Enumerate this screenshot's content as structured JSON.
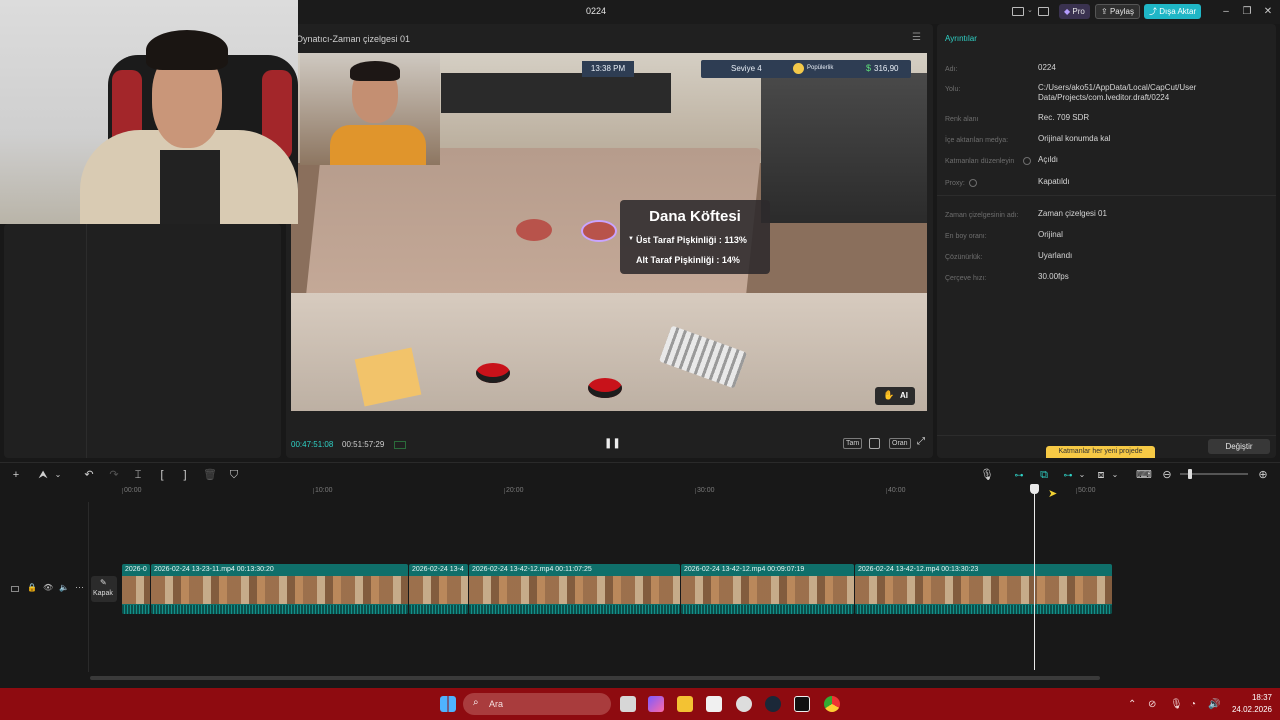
{
  "window": {
    "title": "0224",
    "pro": "Pro",
    "share": "Paylaş",
    "export": "Dışa Aktar"
  },
  "player": {
    "title": "Oynatıcı-Zaman çizelgesi 01",
    "current_time": "00:47:51:08",
    "total_time": "00:51:57:29",
    "btn_full": "Tam",
    "btn_ratio": "Oran",
    "ai": "AI"
  },
  "game": {
    "clock": "13:38 PM",
    "level": "Seviye 4",
    "popularity": "Popülerlik",
    "money": "316,90",
    "popup_title": "Dana Köftesi",
    "popup_line1": "Üst Taraf Pişkinliği : 113%",
    "popup_line2": "Alt Taraf Pişkinliği : 14%"
  },
  "details": {
    "heading": "Ayrıntılar",
    "rows": [
      {
        "label": "Adı:",
        "value": "0224"
      },
      {
        "label": "Yolu:",
        "value": "C:/Users/ako51/AppData/Local/CapCut/User Data/Projects/com.lveditor.draft/0224"
      },
      {
        "label": "Renk alanı",
        "value": "Rec. 709 SDR"
      },
      {
        "label": "İçe aktarılan medya:",
        "value": "Orijinal konumda kal"
      },
      {
        "label": "Katmanları düzenleyin",
        "value": "Açıldı"
      },
      {
        "label": "Proxy:",
        "value": "Kapatıldı"
      },
      {
        "label": "Zaman çizelgesinin adı:",
        "value": "Zaman çizelgesi 01"
      },
      {
        "label": "En boy oranı:",
        "value": "Orijinal"
      },
      {
        "label": "Çözünürlük:",
        "value": "Uyarlandı"
      },
      {
        "label": "Çerçeve hızı:",
        "value": "30.00fps"
      }
    ],
    "change_button": "Değiştir",
    "tip": "Katmanlar her yeni projede"
  },
  "timeline": {
    "ruler": [
      "00:00",
      "10:00",
      "20:00",
      "30:00",
      "40:00",
      "50:00"
    ],
    "cover_label": "Kapak",
    "clips": [
      {
        "label": "2026-0"
      },
      {
        "label": "2026-02-24 13-23-11.mp4   00:13:30:20"
      },
      {
        "label": "2026-02-24 13-4"
      },
      {
        "label": "2026-02-24 13-42-12.mp4   00:11:07:25"
      },
      {
        "label": "2026-02-24 13-42-12.mp4   00:09:07:19"
      },
      {
        "label": "2026-02-24 13-42-12.mp4   00:13:30:23"
      }
    ]
  },
  "taskbar": {
    "search": "Ara",
    "time": "18:37",
    "date": "24.02.2026"
  }
}
